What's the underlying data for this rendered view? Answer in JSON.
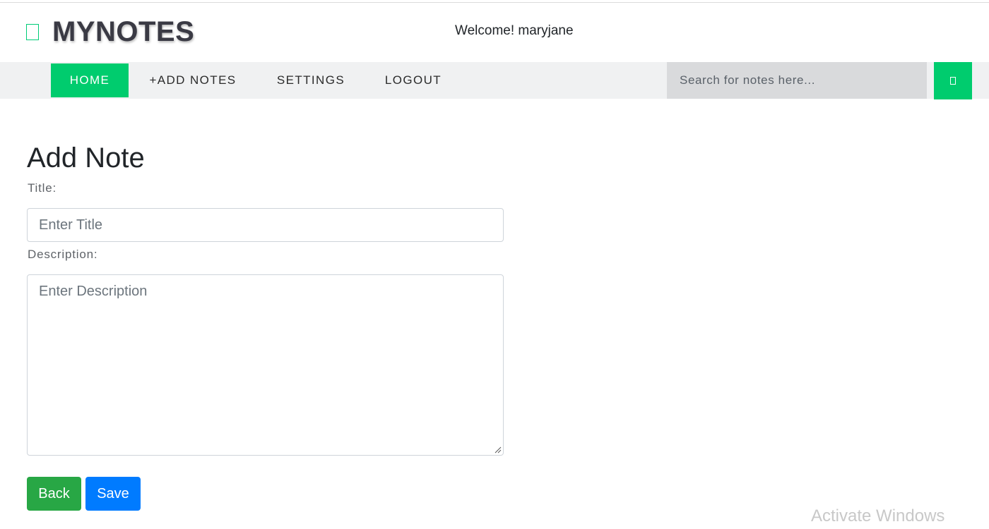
{
  "header": {
    "brand": "MYNOTES",
    "logo_icon": "note-icon",
    "welcome": "Welcome! maryjane"
  },
  "nav": {
    "items": [
      {
        "label": "HOME",
        "active": true
      },
      {
        "label": "+ADD NOTES",
        "active": false
      },
      {
        "label": "SETTINGS",
        "active": false
      },
      {
        "label": "LOGOUT",
        "active": false
      }
    ],
    "search_placeholder": "Search for notes here...",
    "search_icon": "search-icon"
  },
  "form": {
    "heading": "Add Note",
    "title_label": "Title:",
    "title_placeholder": "Enter Title",
    "title_value": "",
    "description_label": "Description:",
    "description_placeholder": "Enter Description",
    "description_value": "",
    "back_label": "Back",
    "save_label": "Save"
  },
  "watermark": "Activate Windows",
  "colors": {
    "accent": "#00cc6e",
    "back_button": "#28a745",
    "save_button": "#007bff",
    "nav_background": "#f0f1f2",
    "search_background": "#d9dadc"
  }
}
